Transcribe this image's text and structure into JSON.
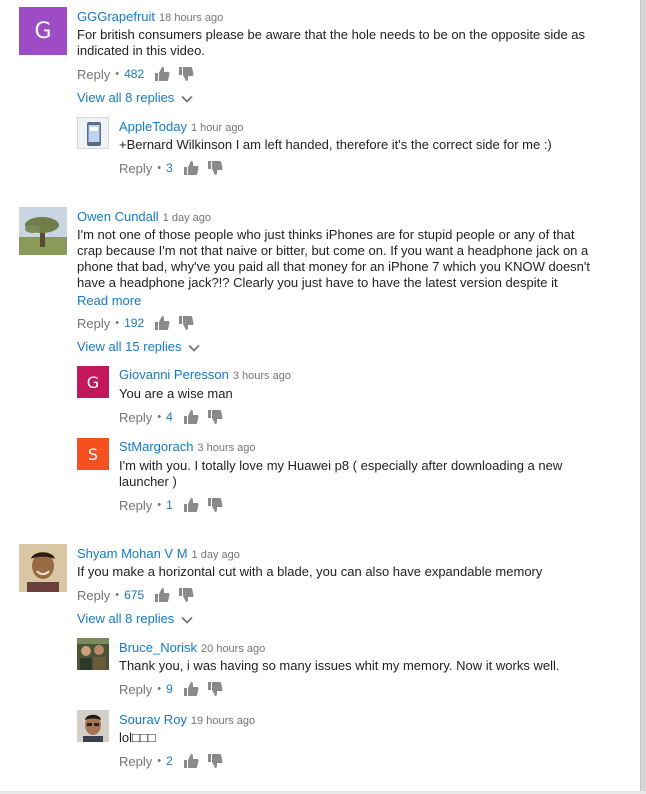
{
  "colors": {
    "link": "#167ac6",
    "meta": "#767676",
    "text": "#222222"
  },
  "comments": [
    {
      "author": "GGGrapefruit",
      "time": "18 hours ago",
      "avatar_letter": "G",
      "avatar_color": "#9c4cc4",
      "text": "For british consumers please be aware that the hole needs to be on the opposite side as indicated in this video.",
      "reply_label": "Reply",
      "likes": "482",
      "view_replies": "View all 8 replies",
      "replies": [
        {
          "author": "AppleToday",
          "time": "1 hour ago",
          "avatar_icon": "phone-icon",
          "text": "+Bernard Wilkinson I am left handed, therefore it's the correct side for me :)",
          "reply_label": "Reply",
          "likes": "3"
        }
      ]
    },
    {
      "author": "Owen Cundall",
      "time": "1 day ago",
      "avatar_icon": "tree-photo",
      "text": "I'm not one of those people who just thinks iPhones are for stupid people or any of that crap because I'm not that naive or bitter, but come on. If you want a headphone jack on a phone that bad, why've you paid all that money for an iPhone 7 which you KNOW doesn't have a headphone jack?!? Clearly you just have to have the latest version despite it clearly not",
      "read_more": "Read more",
      "reply_label": "Reply",
      "likes": "192",
      "view_replies": "View all 15 replies",
      "replies": [
        {
          "author": "Giovanni Peresson",
          "time": "3 hours ago",
          "avatar_letter": "G",
          "avatar_color": "#c2185b",
          "text": "You are a wise man",
          "reply_label": "Reply",
          "likes": "4"
        },
        {
          "author": "StMargorach",
          "time": "3 hours ago",
          "avatar_letter": "S",
          "avatar_color": "#f4511e",
          "text": "I'm with you. I totally love my Huawei p8 ( especially after downloading a new launcher )",
          "reply_label": "Reply",
          "likes": "1"
        }
      ]
    },
    {
      "author": "Shyam Mohan V M",
      "time": "1 day ago",
      "avatar_icon": "person-photo",
      "text": "If you make a horizontal cut with a blade, you can also have expandable memory",
      "reply_label": "Reply",
      "likes": "675",
      "view_replies": "View all 8 replies",
      "replies": [
        {
          "author": "Bruce_Norisk",
          "time": "20 hours ago",
          "avatar_icon": "group-photo",
          "text": "Thank you, i was having so many issues whit my memory. Now it works well.",
          "reply_label": "Reply",
          "likes": "9"
        },
        {
          "author": "Sourav Roy",
          "time": "19 hours ago",
          "avatar_icon": "person-photo",
          "text": "lol□□□",
          "reply_label": "Reply",
          "likes": "2"
        }
      ]
    }
  ]
}
